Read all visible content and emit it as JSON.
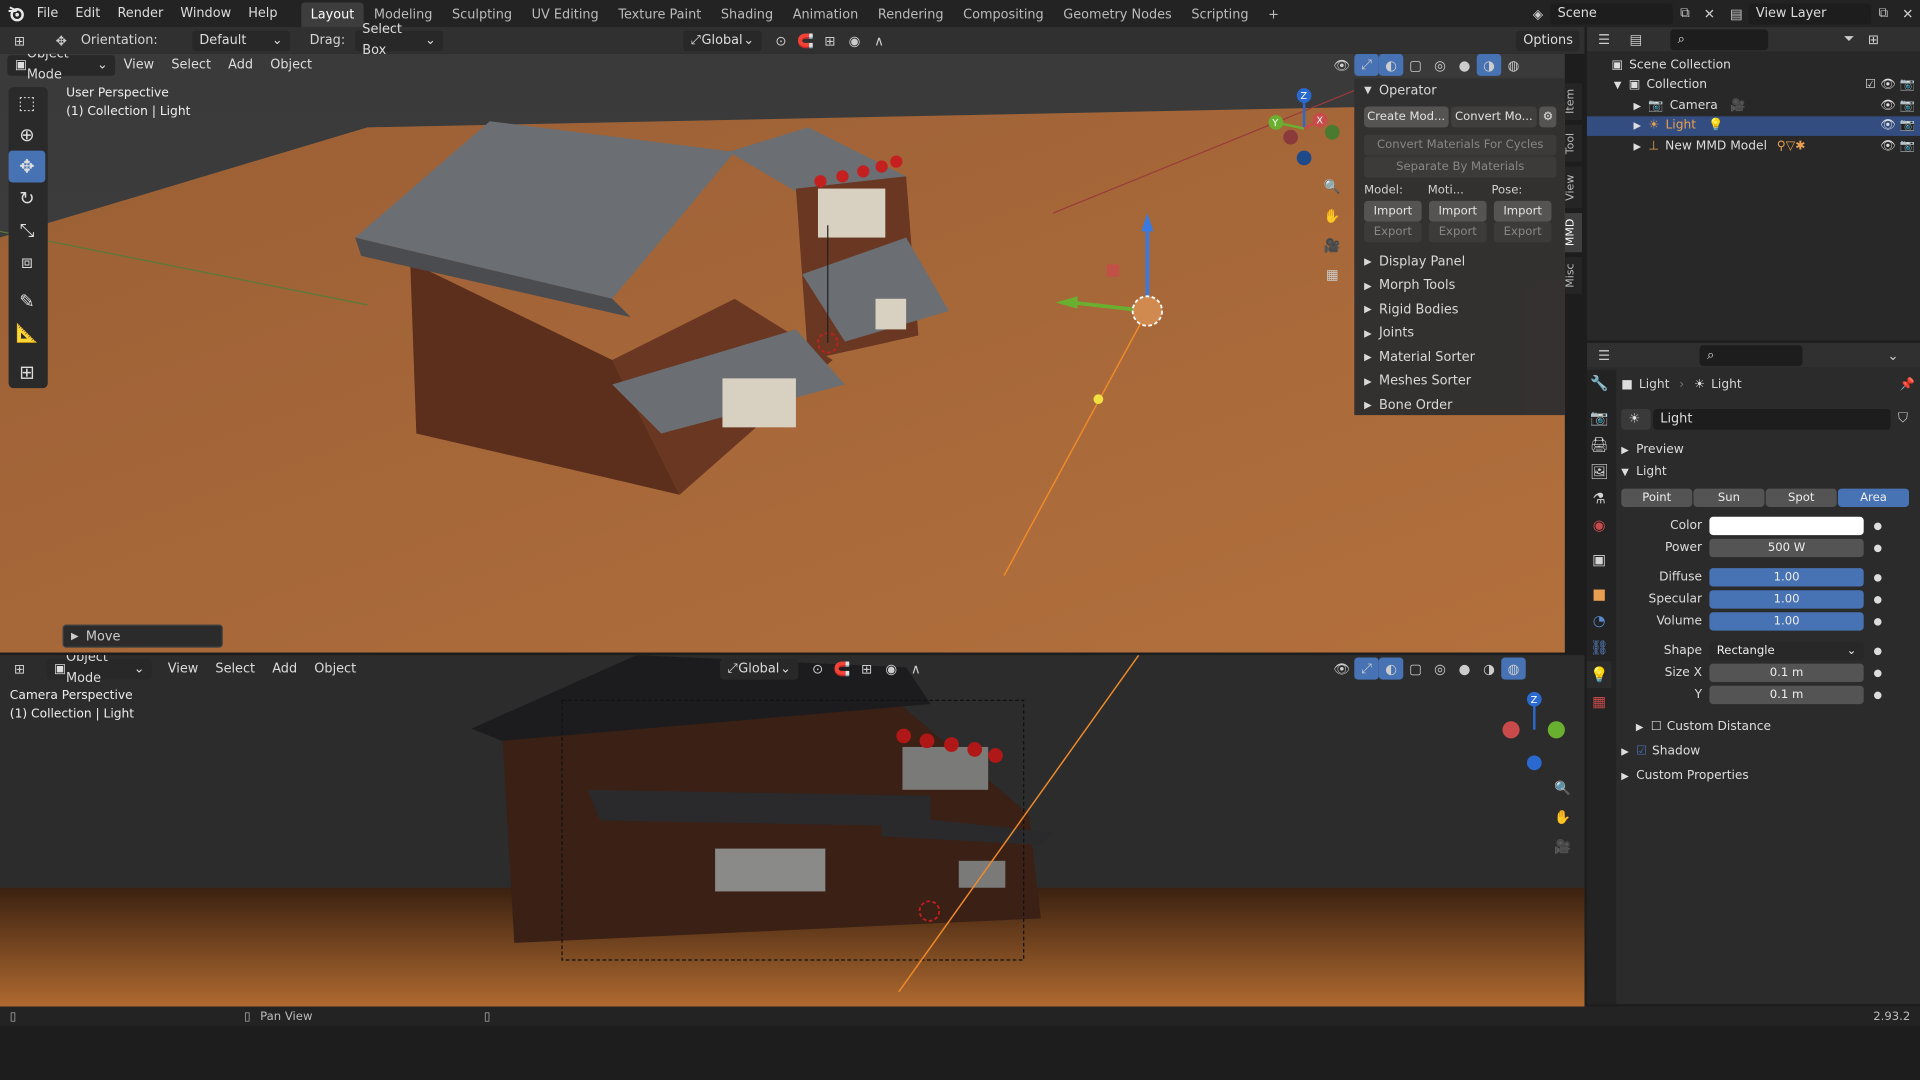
{
  "topbar": {
    "menus": [
      "File",
      "Edit",
      "Render",
      "Window",
      "Help"
    ],
    "workspaces": [
      "Layout",
      "Modeling",
      "Sculpting",
      "UV Editing",
      "Texture Paint",
      "Shading",
      "Animation",
      "Rendering",
      "Compositing",
      "Geometry Nodes",
      "Scripting"
    ],
    "add": "+",
    "scene": "Scene",
    "view_layer": "View Layer"
  },
  "toolheader": {
    "orientation_label": "Orientation:",
    "orientation_value": "Default",
    "drag_label": "Drag:",
    "drag_value": "Select Box",
    "transform": "Global",
    "options": "Options"
  },
  "viewport_top": {
    "mode": "Object Mode",
    "menus": [
      "View",
      "Select",
      "Add",
      "Object"
    ],
    "title": "User Perspective",
    "subtitle": "(1) Collection | Light",
    "last_op": "Move"
  },
  "viewport_bottom": {
    "mode": "Object Mode",
    "menus": [
      "View",
      "Select",
      "Add",
      "Object"
    ],
    "transform": "Global",
    "title": "Camera Perspective",
    "subtitle": "(1) Collection | Light"
  },
  "npanel": {
    "operator": "Operator",
    "create_mod": "Create Mod...",
    "convert_mo": "Convert Mo...",
    "convert_cycles": "Convert Materials For Cycles",
    "separate": "Separate By Materials",
    "model": "Model:",
    "moti": "Moti...",
    "pose": "Pose:",
    "import": "Import",
    "export": "Export",
    "rows": [
      "Display Panel",
      "Morph Tools",
      "Rigid Bodies",
      "Joints",
      "Material Sorter",
      "Meshes Sorter",
      "Bone Order"
    ],
    "tabs": [
      "Item",
      "Tool",
      "View",
      "MMD",
      "Misc"
    ]
  },
  "outliner": {
    "scene_collection": "Scene Collection",
    "collection": "Collection",
    "items": [
      "Camera",
      "Light",
      "New MMD Model"
    ]
  },
  "properties": {
    "breadcrumb_obj": "Light",
    "breadcrumb_data": "Light",
    "datablock": "Light",
    "preview": "Preview",
    "light": "Light",
    "types": [
      "Point",
      "Sun",
      "Spot",
      "Area"
    ],
    "color_label": "Color",
    "power_label": "Power",
    "power": "500 W",
    "diffuse_label": "Diffuse",
    "diffuse": "1.00",
    "specular_label": "Specular",
    "specular": "1.00",
    "volume_label": "Volume",
    "volume": "1.00",
    "shape_label": "Shape",
    "shape": "Rectangle",
    "sizex_label": "Size X",
    "sizex": "0.1 m",
    "y_label": "Y",
    "y": "0.1 m",
    "custom_distance": "Custom Distance",
    "shadow": "Shadow",
    "custom_props": "Custom Properties"
  },
  "status": {
    "pan": "Pan View",
    "version": "2.93.2"
  },
  "colors": {
    "accent": "#4772b3",
    "bg": "#1d1d1d",
    "ground": "#a0663a"
  }
}
